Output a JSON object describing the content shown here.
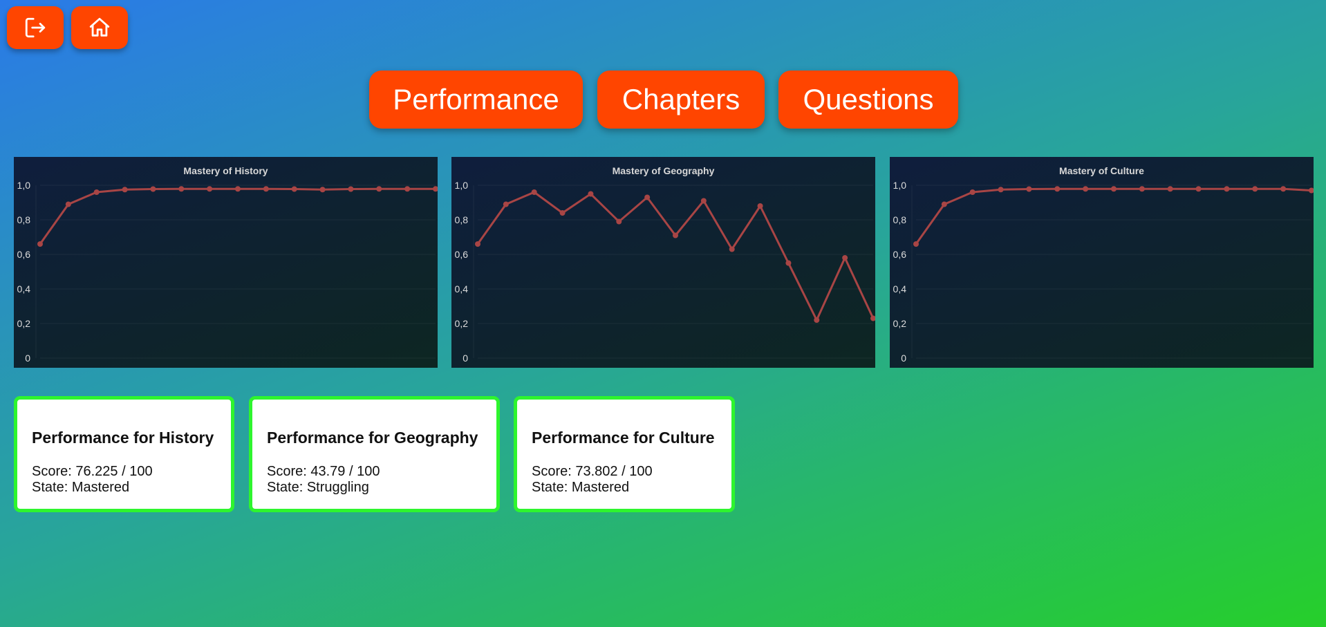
{
  "toolbar": {
    "logout_icon": "logout-icon",
    "home_icon": "home-icon"
  },
  "nav": {
    "tabs": [
      "Performance",
      "Chapters",
      "Questions"
    ]
  },
  "colors": {
    "accent": "#ff4500",
    "card_border": "#2ef52e",
    "series": "#a84545"
  },
  "chart_data": [
    {
      "type": "line",
      "title": "Mastery of History",
      "y_ticks": [
        "1,0",
        "0,8",
        "0,6",
        "0,4",
        "0,2",
        "0"
      ],
      "ylim": [
        0,
        1
      ],
      "grid": true,
      "values": [
        0.66,
        0.89,
        0.96,
        0.975,
        0.978,
        0.979,
        0.979,
        0.979,
        0.979,
        0.978,
        0.975,
        0.978,
        0.979,
        0.979,
        0.979
      ]
    },
    {
      "type": "line",
      "title": "Mastery of Geography",
      "y_ticks": [
        "1,0",
        "0,8",
        "0,6",
        "0,4",
        "0,2",
        "0"
      ],
      "ylim": [
        0,
        1
      ],
      "grid": true,
      "values": [
        0.66,
        0.89,
        0.96,
        0.84,
        0.95,
        0.79,
        0.93,
        0.71,
        0.91,
        0.63,
        0.88,
        0.55,
        0.22,
        0.58,
        0.23
      ]
    },
    {
      "type": "line",
      "title": "Mastery of Culture",
      "y_ticks": [
        "1,0",
        "0,8",
        "0,6",
        "0,4",
        "0,2",
        "0"
      ],
      "ylim": [
        0,
        1
      ],
      "grid": true,
      "values": [
        0.66,
        0.89,
        0.96,
        0.975,
        0.978,
        0.979,
        0.979,
        0.979,
        0.979,
        0.979,
        0.979,
        0.979,
        0.979,
        0.979,
        0.97
      ]
    }
  ],
  "cards": [
    {
      "title": "Performance for History",
      "score": "Score: 76.225 / 100",
      "state": "State: Mastered"
    },
    {
      "title": "Performance for Geography",
      "score": "Score: 43.79 / 100",
      "state": "State: Struggling"
    },
    {
      "title": "Performance for Culture",
      "score": "Score: 73.802 / 100",
      "state": "State: Mastered"
    }
  ]
}
